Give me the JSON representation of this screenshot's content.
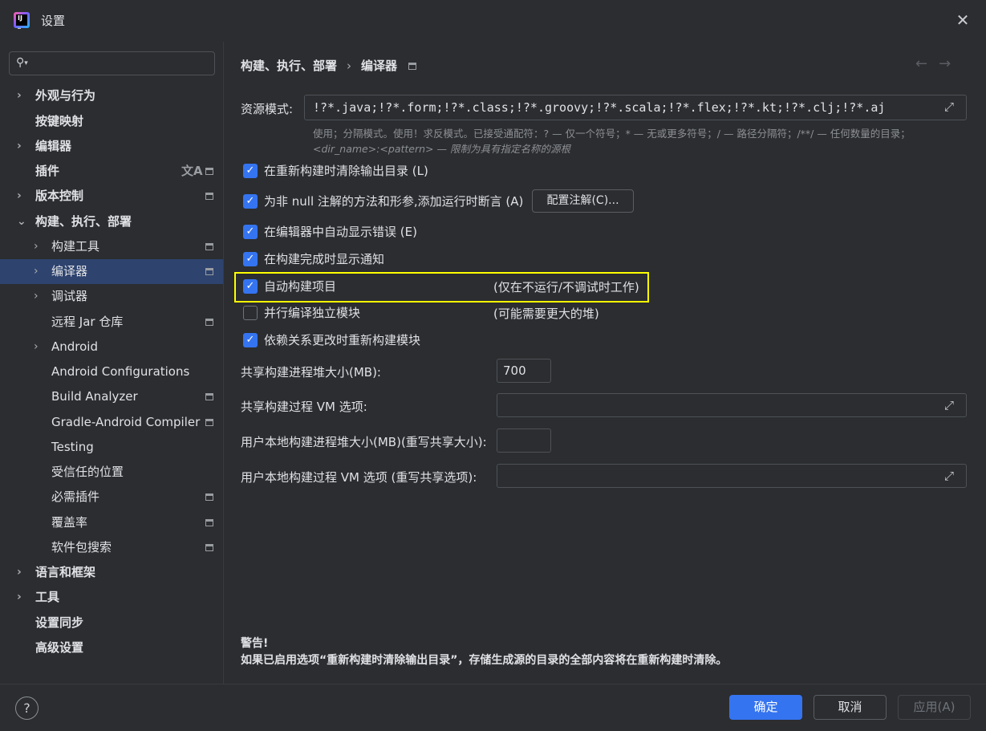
{
  "window": {
    "title": "设置"
  },
  "sidebar": {
    "search_placeholder": "",
    "items": [
      {
        "label": "外观与行为",
        "chevron": "›",
        "bold": true
      },
      {
        "label": "按键映射",
        "bold": true
      },
      {
        "label": "编辑器",
        "chevron": "›",
        "bold": true
      },
      {
        "label": "插件",
        "bold": true
      },
      {
        "label": "版本控制",
        "chevron": "›",
        "bold": true
      },
      {
        "label": "构建、执行、部署",
        "chevron": "⌄",
        "bold": true
      },
      {
        "label": "构建工具",
        "chevron": "›"
      },
      {
        "label": "编译器",
        "chevron": "›"
      },
      {
        "label": "调试器",
        "chevron": "›"
      },
      {
        "label": "远程 Jar 仓库"
      },
      {
        "label": "Android",
        "chevron": "›"
      },
      {
        "label": "Android Configurations"
      },
      {
        "label": "Build Analyzer"
      },
      {
        "label": "Gradle-Android Compiler"
      },
      {
        "label": "Testing"
      },
      {
        "label": "受信任的位置"
      },
      {
        "label": "必需插件"
      },
      {
        "label": "覆盖率"
      },
      {
        "label": "软件包搜索"
      },
      {
        "label": "语言和框架",
        "chevron": "›",
        "bold": true
      },
      {
        "label": "工具",
        "chevron": "›",
        "bold": true
      },
      {
        "label": "设置同步",
        "bold": true
      },
      {
        "label": "高级设置",
        "bold": true
      }
    ]
  },
  "content": {
    "breadcrumb": {
      "parent": "构建、执行、部署",
      "separator": "›",
      "current": "编译器"
    },
    "nav": {
      "back": "←",
      "forward": "→"
    },
    "resource_patterns": {
      "label": "资源模式:",
      "value": "!?*.java;!?*.form;!?*.class;!?*.groovy;!?*.scala;!?*.flex;!?*.kt;!?*.clj;!?*.aj",
      "hint1": "使用；分隔模式。使用！求反模式。已接受通配符：? — 仅一个符号；* — 无或更多符号；/ — 路径分隔符；/**/ — 任何数量的目录；",
      "hint2": "<dir_name>:<pattern> — 限制为具有指定名称的源根"
    },
    "checkboxes": [
      {
        "label": "在重新构建时清除输出目录 (L)",
        "checked": true
      },
      {
        "label": "为非 null 注解的方法和形参,添加运行时断言 (A)",
        "checked": true
      },
      {
        "label": "在编辑器中自动显示错误 (E)",
        "checked": true
      },
      {
        "label": "在构建完成时显示通知",
        "checked": true
      },
      {
        "label": "自动构建项目",
        "checked": true,
        "note": "(仅在不运行/不调试时工作)"
      },
      {
        "label": "并行编译独立模块",
        "checked": false,
        "note": "(可能需要更大的堆)"
      },
      {
        "label": "依赖关系更改时重新构建模块",
        "checked": true
      }
    ],
    "configure_annotations_button": "配置注解(C)...",
    "fields": {
      "heap_label": "共享构建进程堆大小(MB):",
      "heap_value": "700",
      "vm_label": "共享构建过程 VM 选项:",
      "vm_value": "",
      "user_heap_label": "用户本地构建进程堆大小(MB)(重写共享大小):",
      "user_heap_value": "",
      "user_vm_label": "用户本地构建过程 VM 选项 (重写共享选项):",
      "user_vm_value": ""
    },
    "warning": {
      "title": "警告!",
      "text": "如果已启用选项“重新构建时清除输出目录”，存储生成源的目录的全部内容将在重新构建时清除。"
    }
  },
  "footer": {
    "help": "?",
    "ok": "确定",
    "cancel": "取消",
    "apply": "应用(A)"
  },
  "colors": {
    "accent": "#3574f0",
    "selection": "#2e436e",
    "highlight_frame": "#ffff00",
    "background": "#2b2d30"
  },
  "icons": [
    "app-logo-icon",
    "close-icon",
    "search-icon",
    "chevron-icon",
    "project-scope-icon",
    "translate-icon",
    "expand-icon",
    "help-icon",
    "checkmark-icon"
  ]
}
